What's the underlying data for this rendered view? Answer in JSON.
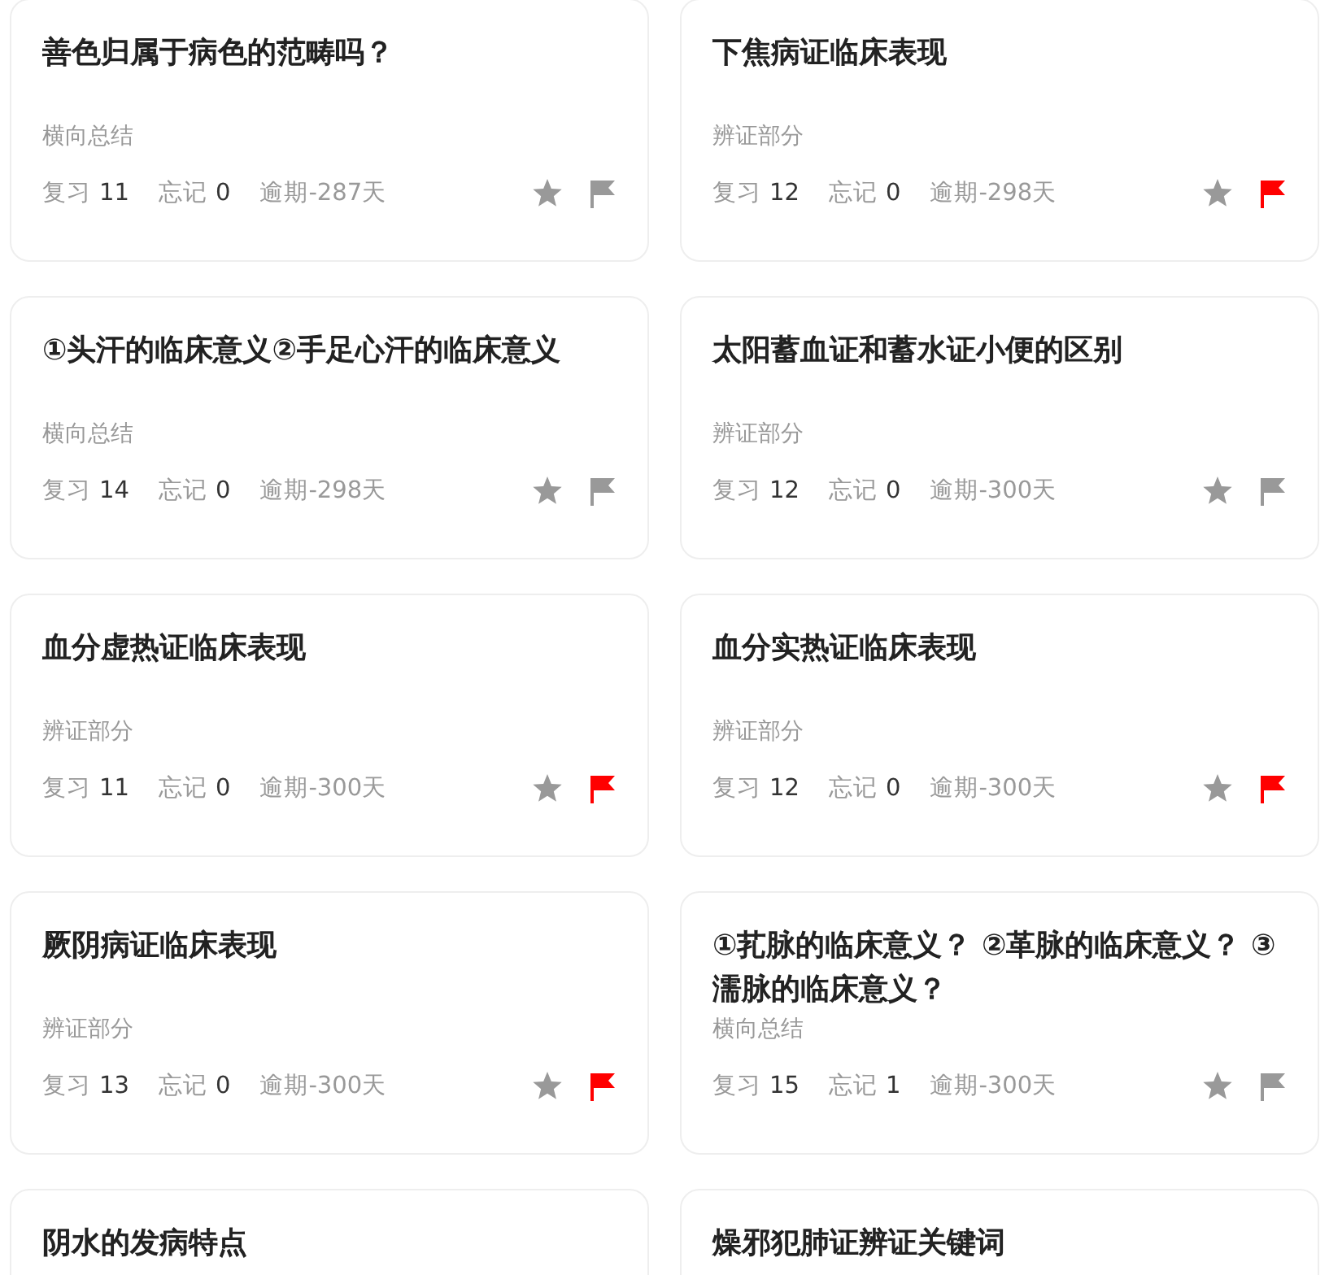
{
  "cards": [
    {
      "title": "善色归属于病色的范畴吗？",
      "category": "横向总结",
      "review_label": "复习",
      "review_count": "11",
      "forget_label": "忘记",
      "forget_count": "0",
      "overdue": "逾期-287天",
      "starred": false,
      "flagged": false
    },
    {
      "title": "下焦病证临床表现",
      "category": "辨证部分",
      "review_label": "复习",
      "review_count": "12",
      "forget_label": "忘记",
      "forget_count": "0",
      "overdue": "逾期-298天",
      "starred": false,
      "flagged": true
    },
    {
      "title": "①头汗的临床意义②手足心汗的临床意义",
      "category": "横向总结",
      "review_label": "复习",
      "review_count": "14",
      "forget_label": "忘记",
      "forget_count": "0",
      "overdue": "逾期-298天",
      "starred": false,
      "flagged": false
    },
    {
      "title": "太阳蓄血证和蓄水证小便的区别",
      "category": "辨证部分",
      "review_label": "复习",
      "review_count": "12",
      "forget_label": "忘记",
      "forget_count": "0",
      "overdue": "逾期-300天",
      "starred": false,
      "flagged": false
    },
    {
      "title": "血分虚热证临床表现",
      "category": "辨证部分",
      "review_label": "复习",
      "review_count": "11",
      "forget_label": "忘记",
      "forget_count": "0",
      "overdue": "逾期-300天",
      "starred": false,
      "flagged": true
    },
    {
      "title": "血分实热证临床表现",
      "category": "辨证部分",
      "review_label": "复习",
      "review_count": "12",
      "forget_label": "忘记",
      "forget_count": "0",
      "overdue": "逾期-300天",
      "starred": false,
      "flagged": true
    },
    {
      "title": "厥阴病证临床表现",
      "category": "辨证部分",
      "review_label": "复习",
      "review_count": "13",
      "forget_label": "忘记",
      "forget_count": "0",
      "overdue": "逾期-300天",
      "starred": false,
      "flagged": true
    },
    {
      "title": "①芤脉的临床意义？ ②革脉的临床意义？ ③濡脉的临床意义？",
      "category": "横向总结",
      "review_label": "复习",
      "review_count": "15",
      "forget_label": "忘记",
      "forget_count": "1",
      "overdue": "逾期-300天",
      "starred": false,
      "flagged": false
    },
    {
      "title": "阴水的发病特点"
    },
    {
      "title": "燥邪犯肺证辨证关键词"
    }
  ]
}
